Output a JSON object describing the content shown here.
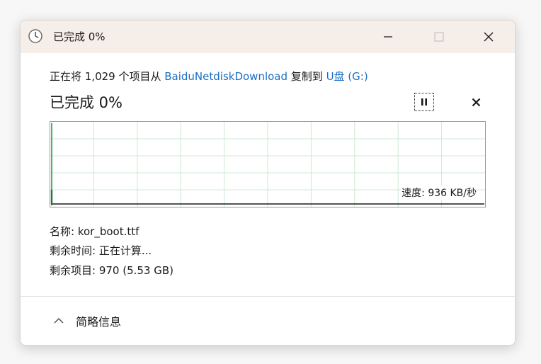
{
  "window": {
    "title": "已完成 0%"
  },
  "operation": {
    "prefix": "正在将 1,029 个项目从 ",
    "source": "BaiduNetdiskDownload",
    "middle": " 复制到 ",
    "destination": "U盘 (G:)"
  },
  "status": {
    "big_label": "已完成 0%"
  },
  "graph": {
    "speed_label": "速度: 936 KB/秒",
    "progress_fraction": 0.0
  },
  "details": {
    "name_line": "名称: kor_boot.ttf",
    "time_line": "剩余时间: 正在计算...",
    "items_line": "剩余项目: 970 (5.53 GB)"
  },
  "footer": {
    "toggle_label": "简略信息"
  },
  "colors": {
    "titlebar": "#f6efe9",
    "link": "#1a6fc4",
    "grid": "#cde9d3",
    "progress": "#22a84a"
  },
  "icons": {
    "title": "clock-icon",
    "minimize": "minimize-icon",
    "maximize": "maximize-icon",
    "close": "close-icon",
    "pause": "pause-icon",
    "cancel": "cancel-icon",
    "chevron": "chevron-up-icon"
  }
}
